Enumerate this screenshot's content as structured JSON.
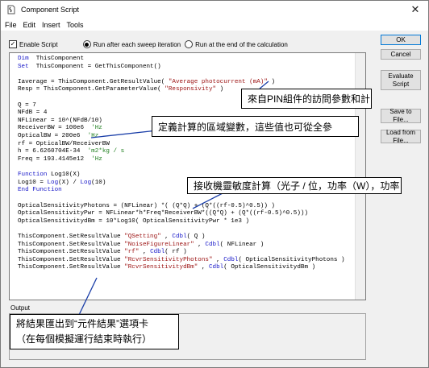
{
  "window": {
    "title": "Component Script",
    "close_glyph": "✕"
  },
  "menu": [
    "File",
    "Edit",
    "Insert",
    "Tools"
  ],
  "options": {
    "enable_script": "Enable Script",
    "enable_checked": true,
    "radio_after_sweep": "Run after each sweep iteration",
    "radio_after_sweep_selected": true,
    "radio_end_calc": "Run at the end of the calculation"
  },
  "code_lines": [
    [
      [
        "kw",
        "Dim"
      ],
      [
        "",
        "  ThisComponent"
      ]
    ],
    [
      [
        "kw",
        "Set"
      ],
      [
        "",
        "  ThisComponent = GetThisComponent()"
      ]
    ],
    [
      [
        "",
        ""
      ]
    ],
    [
      [
        "",
        "Iaverage = ThisComponent.GetResultValue( "
      ],
      [
        "str",
        "\"Average photocurrent (mA)\""
      ],
      [
        "",
        " )"
      ]
    ],
    [
      [
        "",
        "Resp = ThisComponent.GetParameterValue( "
      ],
      [
        "str",
        "\"Responsivity\""
      ],
      [
        "",
        " )"
      ]
    ],
    [
      [
        "",
        ""
      ]
    ],
    [
      [
        "",
        "Q = 7"
      ]
    ],
    [
      [
        "",
        "NFdB = 4"
      ]
    ],
    [
      [
        "",
        "NFLinear = 10^(NFdB/10)"
      ]
    ],
    [
      [
        "",
        "ReceiverBW = 100e6  "
      ],
      [
        "cmt",
        "'Hz"
      ]
    ],
    [
      [
        "",
        "OpticalBW = 200e6  "
      ],
      [
        "cmt",
        "'Hz"
      ]
    ],
    [
      [
        "",
        "rf = OpticalBW/ReceiverBW"
      ]
    ],
    [
      [
        "",
        "h = 6.6260704E-34  "
      ],
      [
        "cmt",
        "'m2*kg / s"
      ]
    ],
    [
      [
        "",
        "Freq = 193.4145e12  "
      ],
      [
        "cmt",
        "'Hz"
      ]
    ],
    [
      [
        "",
        ""
      ]
    ],
    [
      [
        "kw",
        "Function"
      ],
      [
        "",
        " Log10(X)"
      ]
    ],
    [
      [
        "",
        "Log10 = "
      ],
      [
        "kw",
        "Log"
      ],
      [
        "",
        "(X) / "
      ],
      [
        "kw",
        "Log"
      ],
      [
        "",
        "(10)"
      ]
    ],
    [
      [
        "kw",
        "End Function"
      ]
    ],
    [
      [
        "",
        ""
      ]
    ],
    [
      [
        "",
        "OpticalSensitivityPhotons = (NFLinear) *( (Q*Q) + (Q*((rf-0.5)^0.5)) )"
      ]
    ],
    [
      [
        "",
        "OpticalSensitivityPwr = NFLinear*h*Freq*ReceiverBW*((Q*Q) + (Q*((rf-0.5)^0.5)))"
      ]
    ],
    [
      [
        "",
        "OpticalSensitivitydBm = 10*Log10( OpticalSensitivityPwr * 1e3 )"
      ]
    ],
    [
      [
        "",
        ""
      ]
    ],
    [
      [
        "",
        "ThisComponent.SetResultValue "
      ],
      [
        "str",
        "\"QSetting\""
      ],
      [
        "",
        " , "
      ],
      [
        "kw",
        "Cdbl"
      ],
      [
        "",
        "( Q )"
      ]
    ],
    [
      [
        "",
        "ThisComponent.SetResultValue "
      ],
      [
        "str",
        "\"NoiseFigureLinear\""
      ],
      [
        "",
        " , "
      ],
      [
        "kw",
        "Cdbl"
      ],
      [
        "",
        "( NFLinear )"
      ]
    ],
    [
      [
        "",
        "ThisComponent.SetResultValue "
      ],
      [
        "str",
        "\"rf\""
      ],
      [
        "",
        " , "
      ],
      [
        "kw",
        "Cdbl"
      ],
      [
        "",
        "( rf )"
      ]
    ],
    [
      [
        "",
        "ThisComponent.SetResultValue "
      ],
      [
        "str",
        "\"RcvrSensitivityPhotons\""
      ],
      [
        "",
        " , "
      ],
      [
        "kw",
        "Cdbl"
      ],
      [
        "",
        "( OpticalSensitivityPhotons )"
      ]
    ],
    [
      [
        "",
        "ThisComponent.SetResultValue "
      ],
      [
        "str",
        "\"RcvrSensitivitydBm\""
      ],
      [
        "",
        " , "
      ],
      [
        "kw",
        "Cdbl"
      ],
      [
        "",
        "( OpticalSensitivitydBm )"
      ]
    ]
  ],
  "output_label": "Output",
  "buttons": {
    "ok": "OK",
    "cancel": "Cancel",
    "evaluate": "Evaluate Script",
    "save": "Save to File...",
    "load": "Load from File..."
  },
  "callouts": {
    "c1": "來自PIN組件的訪問參數和計",
    "c2": "定義計算的區域變數，這些值也可從全參",
    "c3": "接收機靈敏度計算（光子 / 位，功率（W），功率",
    "c4_line1": "將結果匯出到“元件結果”選項卡",
    "c4_line2": "（在每個模擬運行結束時執行）"
  },
  "colors": {
    "keyword": "#1515c8",
    "string": "#9b1010",
    "comment": "#1c7d1c",
    "arrow": "#1a3ea8"
  }
}
